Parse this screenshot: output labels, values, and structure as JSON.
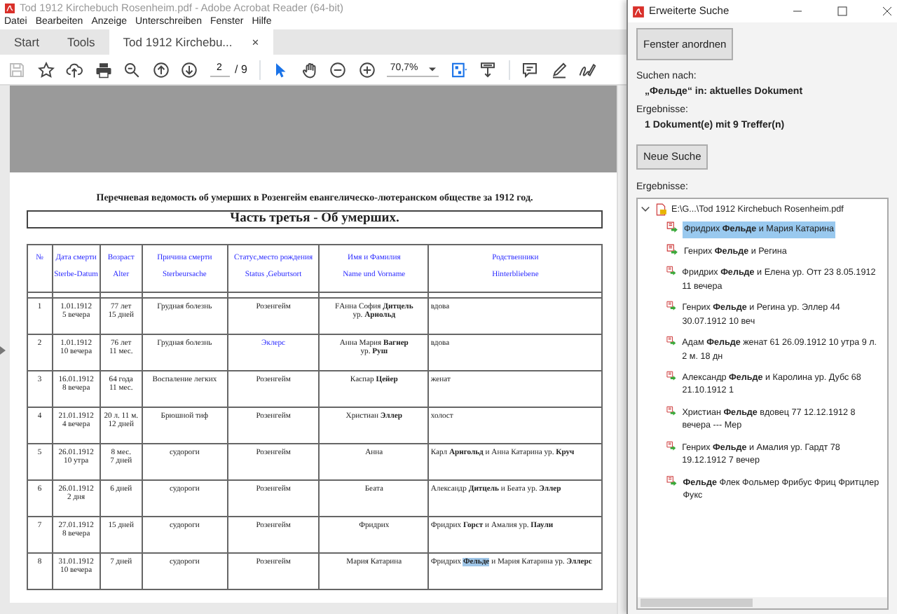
{
  "window": {
    "title": "Tod 1912  Kirchebuch Rosenheim.pdf - Adobe Acrobat Reader (64-bit)"
  },
  "menu": [
    "Datei",
    "Bearbeiten",
    "Anzeige",
    "Unterschreiben",
    "Fenster",
    "Hilfe"
  ],
  "tabs": [
    {
      "label": "Start",
      "selected": false
    },
    {
      "label": "Tools",
      "selected": false
    },
    {
      "label": "Tod 1912  Kirchebu...",
      "selected": true,
      "close": "×"
    }
  ],
  "toolbar": {
    "save_enabled": false,
    "page_current": "2",
    "page_total": "/ 9",
    "pointer_selected": true,
    "zoom": "70,7%"
  },
  "document": {
    "heading": "Перечневая ведомость об умерших в Розенгейм евангелическо-лютеранском обществе за 1912 год.",
    "part_title": "Часть третья  - Об умерших.",
    "columns": [
      {
        "ru": "№"
      },
      {
        "ru": "Дата смерти",
        "de": "Sterbe-Datum"
      },
      {
        "ru": "Возраст",
        "de": "Alter"
      },
      {
        "ru": "Причина смерти",
        "de": "Sterbeursache"
      },
      {
        "ru": "Статус,место рождения",
        "de": "Status ,Geburtsort"
      },
      {
        "ru": "Имя и Фамилия",
        "de": "Name und Vorname"
      },
      {
        "ru": "Родственники",
        "de": "Hinterbliebene"
      }
    ],
    "rows": [
      {
        "cells": [
          "1",
          "1.01.1912\n5 вечера",
          "77 лет\n15 дней",
          "Грудная болезнь",
          "Розенгейм",
          "FАнна София **Дитцель**\nур. **Арнольд**"
        ],
        "status_link": false,
        "relatives": [
          {
            "text": "вдова",
            "hit": false
          }
        ]
      },
      {
        "cells": [
          "2",
          "1.01.1912\n10 вечера",
          "76 лет\n11 мес.",
          "Грудная болезнь",
          "Эклерс",
          "Анна Мария **Вагнер**\nур. **Руш**"
        ],
        "status_link": true,
        "relatives": [
          {
            "text": "вдова",
            "hit": false
          }
        ]
      },
      {
        "cells": [
          "3",
          "16.01.1912\n8 вечера",
          "64 года\n11 мес.",
          "Воспаление легких",
          "Розенгейм",
          "Каспар **Цейер**"
        ],
        "status_link": false,
        "relatives": [
          {
            "text": "женат",
            "hit": false
          }
        ]
      },
      {
        "cells": [
          "4",
          "21.01.1912\n4 вечера",
          "20 л. 11 м.\n12 дней",
          "Брюшной тиф",
          "Розенгейм",
          "Христиан **Эллер**"
        ],
        "status_link": false,
        "relatives": [
          {
            "text": "холост",
            "hit": false
          }
        ]
      },
      {
        "cells": [
          "5",
          "26.01.1912\n10 утра",
          "8 мес.\n7 дней",
          "судороги",
          "Розенгейм",
          "Анна"
        ],
        "status_link": false,
        "relatives": [
          {
            "text": "Карл **Арнгольд** и Анна Катарина ур. **Круч**",
            "hit": false
          }
        ]
      },
      {
        "cells": [
          "6",
          "26.01.1912\n2 дня",
          "6 дней",
          "судороги",
          "Розенгейм",
          "Беата"
        ],
        "status_link": false,
        "relatives": [
          {
            "text": "Александр **Дитцель** и Беата ур. **Эллер**",
            "hit": false
          }
        ]
      },
      {
        "cells": [
          "7",
          "27.01.1912\n8 вечера",
          "15 дней",
          "судороги",
          "Розенгейм",
          "Фридрих"
        ],
        "status_link": false,
        "relatives": [
          {
            "text": "Фридрих **Горст** и Амалия  ур. **Паули**",
            "hit": false
          }
        ]
      },
      {
        "cells": [
          "8",
          "31.01.1912\n10 вечера",
          "7 дней",
          "судороги",
          "Розенгейм",
          "Мария Катарина"
        ],
        "status_link": false,
        "relatives": [
          {
            "text": "Фридрих",
            "hit": false
          },
          {
            "text": "**Фельде**",
            "hit": true
          },
          {
            "text": "и Мария Катарина ур. **Эллерс**",
            "hit": false
          }
        ]
      }
    ]
  },
  "search_panel": {
    "title": "Erweiterte Suche",
    "arrange_button": "Fenster anordnen",
    "search_label": "Suchen nach:",
    "query": "„Фельде“ in: aktuelles Dokument",
    "results_label": "Ergebnisse:",
    "summary": "1 Dokument(e) mit 9 Treffer(n)",
    "new_search_button": "Neue Suche",
    "list_label": "Ergebnisse:",
    "file": {
      "name": "E:\\G...\\Tod 1912  Kirchebuch Rosenheim.pdf",
      "expanded": true,
      "children": [
        {
          "text": "Фридрих **Фельде** и Мария Катарина",
          "selected": true
        },
        {
          "text": "Генрих **Фельде** и Регина",
          "selected": false
        },
        {
          "text": "Фридрих **Фельде** и Елена ур. Отт 23 8.05.1912 11 вечера",
          "selected": false
        },
        {
          "text": "Генрих **Фельде** и Регина ур. Эллер 44 30.07.1912 10 веч",
          "selected": false
        },
        {
          "text": "Адам **Фельде** женат 61 26.09.1912 10 утра 9 л. 2 м. 18 дн",
          "selected": false
        },
        {
          "text": "Александр **Фельде** и Каролина ур. Дубс 68 21.10.1912 1",
          "selected": false
        },
        {
          "text": "Христиан **Фельде** вдовец 77 12.12.1912 8 вечера --- Мер",
          "selected": false
        },
        {
          "text": "Генрих **Фельде** и Амалия ур. Гардт 78 19.12.1912 7 вечер",
          "selected": false
        },
        {
          "text": "**Фельде** Флек Фольмер Фрибус Фриц Фритцлер Фукс",
          "selected": false
        }
      ]
    }
  }
}
